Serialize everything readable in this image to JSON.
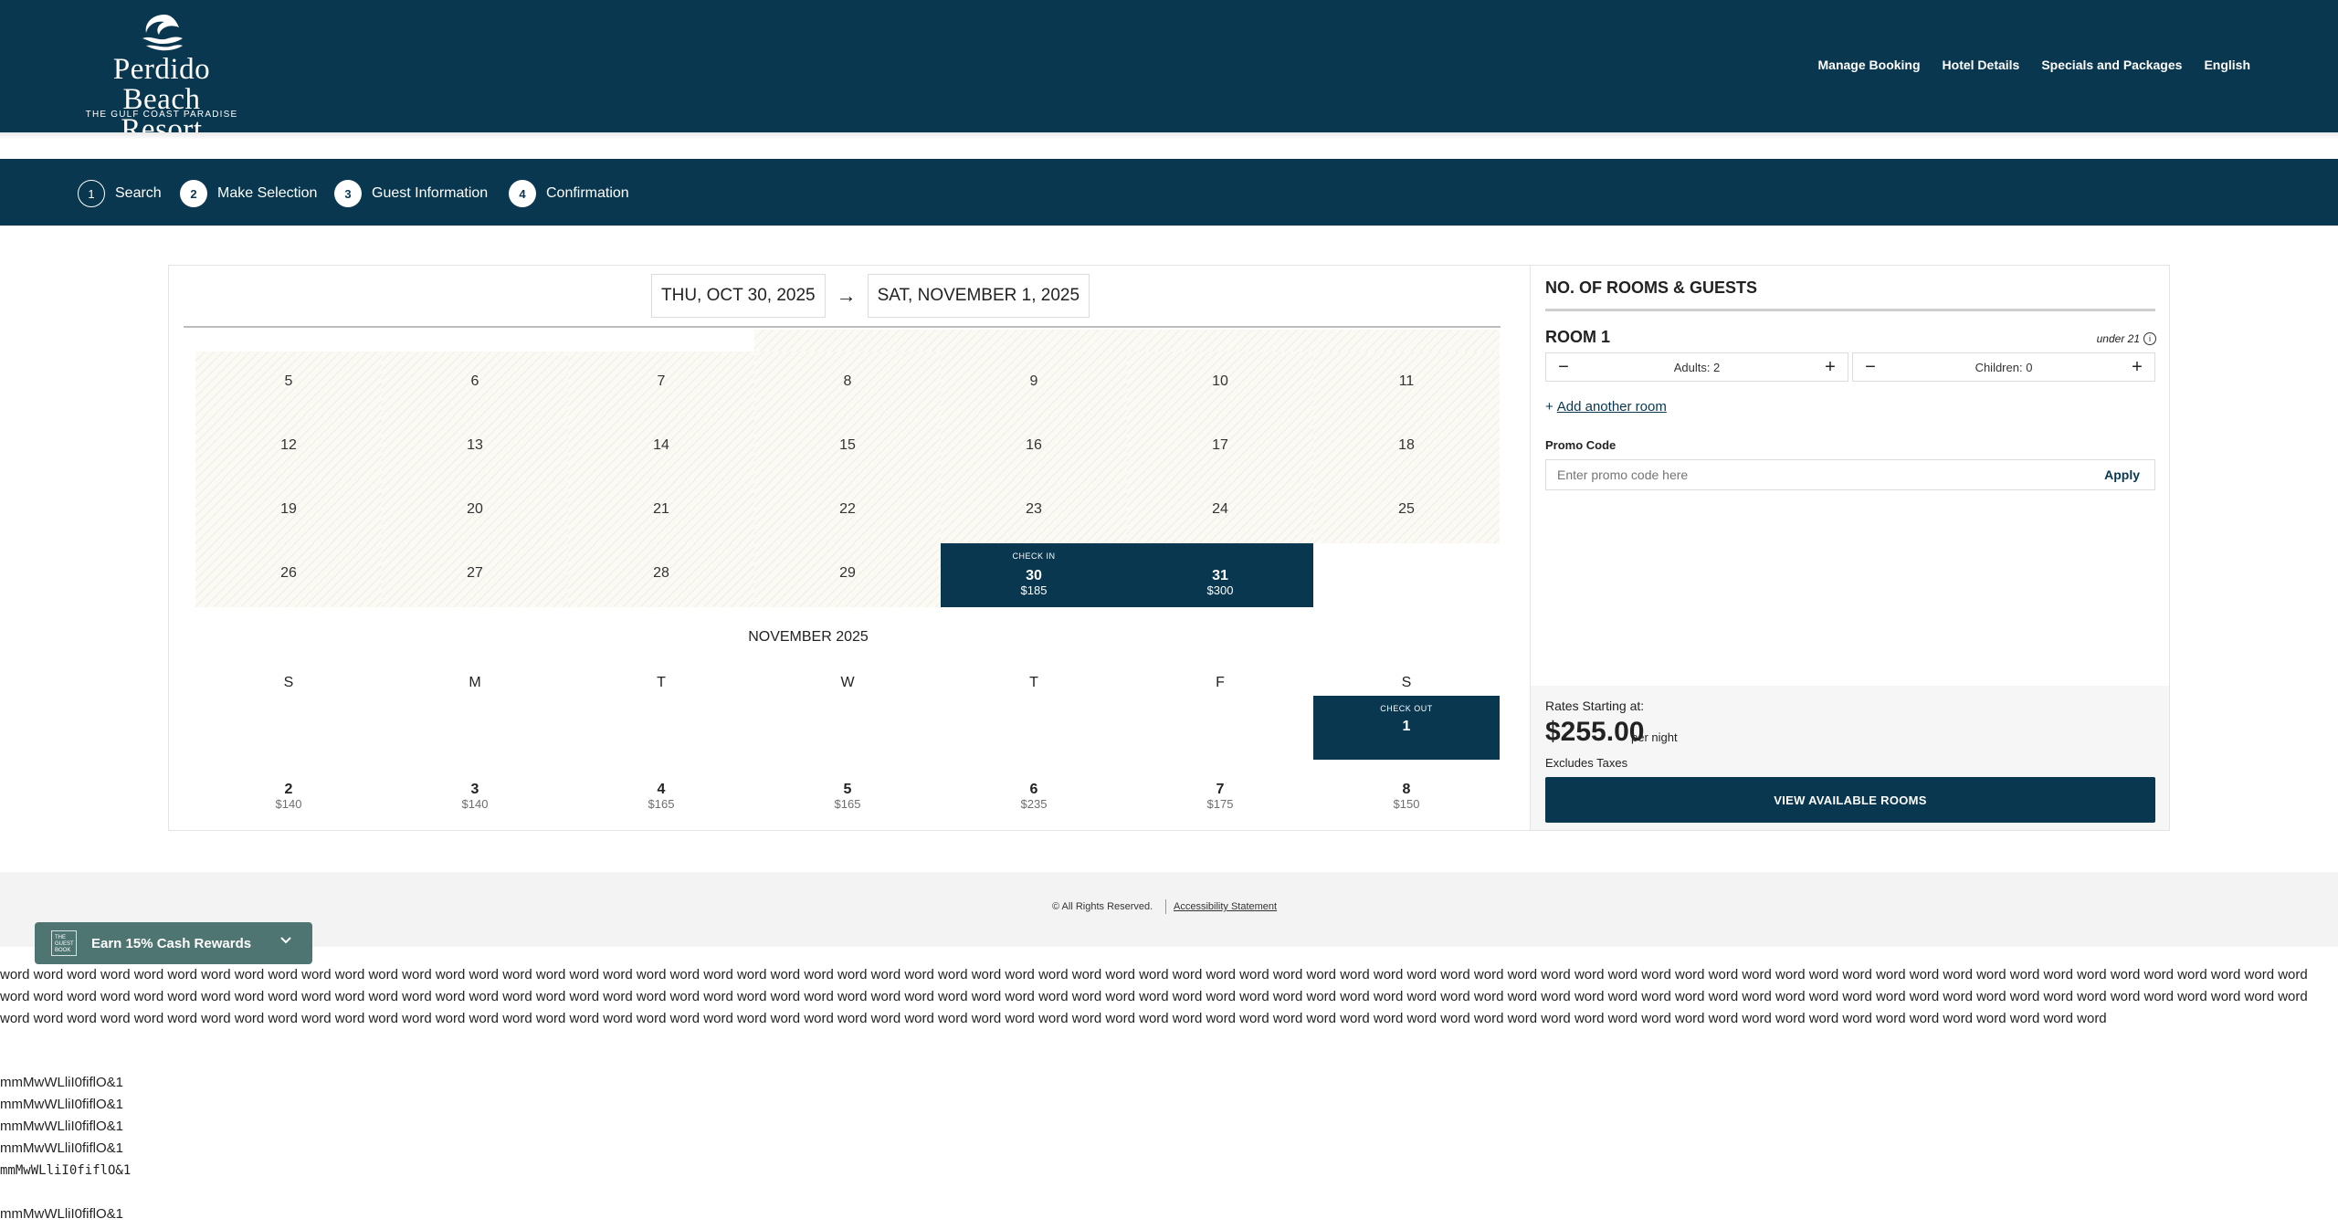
{
  "brand": {
    "name_line1": "Perdido Beach",
    "name_line2": "Resort",
    "tagline": "THE GULF COAST PARADISE"
  },
  "nav": {
    "items": [
      "Manage Booking",
      "Hotel Details",
      "Specials and Packages",
      "English"
    ]
  },
  "steps": [
    {
      "num": "1",
      "label": "Search"
    },
    {
      "num": "2",
      "label": "Make Selection"
    },
    {
      "num": "3",
      "label": "Guest Information"
    },
    {
      "num": "4",
      "label": "Confirmation"
    }
  ],
  "dates": {
    "checkin": "THU, OCT 30, 2025",
    "arrow": "→",
    "checkout": "SAT, NOVEMBER 1, 2025"
  },
  "october": {
    "week1": [
      "5",
      "6",
      "7",
      "8",
      "9",
      "10",
      "11"
    ],
    "week2": [
      "12",
      "13",
      "14",
      "15",
      "16",
      "17",
      "18"
    ],
    "week3": [
      "19",
      "20",
      "21",
      "22",
      "23",
      "24",
      "25"
    ],
    "week4": [
      "26",
      "27",
      "28",
      "29"
    ],
    "checkin_label": "CHECK IN",
    "d30": "30",
    "p30": "$185",
    "d31": "31",
    "p31": "$300"
  },
  "november": {
    "title": "NOVEMBER 2025",
    "weekdays": [
      "S",
      "M",
      "T",
      "W",
      "T",
      "F",
      "S"
    ],
    "checkout_label": "CHECK OUT",
    "checkout_day": "1",
    "week2": [
      {
        "day": "2",
        "price": "$140"
      },
      {
        "day": "3",
        "price": "$140"
      },
      {
        "day": "4",
        "price": "$165"
      },
      {
        "day": "5",
        "price": "$165"
      },
      {
        "day": "6",
        "price": "$235"
      },
      {
        "day": "7",
        "price": "$175"
      },
      {
        "day": "8",
        "price": "$150"
      }
    ]
  },
  "side": {
    "title": "NO. OF ROOMS & GUESTS",
    "room_title": "ROOM 1",
    "under21": "under 21",
    "adults": "Adults: 2",
    "children": "Children: 0",
    "add_room": "Add another room",
    "promo_label": "Promo Code",
    "promo_placeholder": "Enter promo code here",
    "apply": "Apply",
    "rates_label": "Rates Starting at:",
    "price": "$255.00",
    "per_night": "per night",
    "excludes": "Excludes Taxes",
    "view_button": "VIEW AVAILABLE ROOMS"
  },
  "footer": {
    "copyright": "© All Rights Reserved.",
    "accessibility": "Accessibility Statement"
  },
  "rewards": {
    "badge": "THE GUEST BOOK",
    "label": "Earn 15% Cash Rewards"
  },
  "dump": {
    "words": "word word word word word word word word word word word word word word word word word word word word word word word word word word word word word word word word word word word word word word word word word word word word word word word word word word word word word word word word word word word word word word word word word word word word word word word word word word word word word word word word word word word word word word word word word word word word word word word word word word word word word word word word word word word word word word word word word word word word word word word word word word word word word word word word word word word word word word word word word word word word word word word word word word word word word word word word word word word word word word word word word word word word word word word word word word word word word word word word word word word word word word word word word word word word word word word word word word word word word word word word word",
    "lines": [
      "mmMwWLliI0fiflO&1",
      "mmMwWLliI0fiflO&1",
      "mmMwWLliI0fiflO&1",
      "mmMwWLliI0fiflO&1",
      "mmMwWLliI0fiflO&1",
      "mmMwWLliI0fiflO&1"
    ]
  },
  "colors": {
    "brand_navy": "#08374f",
    "rewards_green": "#4f7573",
    "hatch_bg": "#fbfaf5"
  }
}
